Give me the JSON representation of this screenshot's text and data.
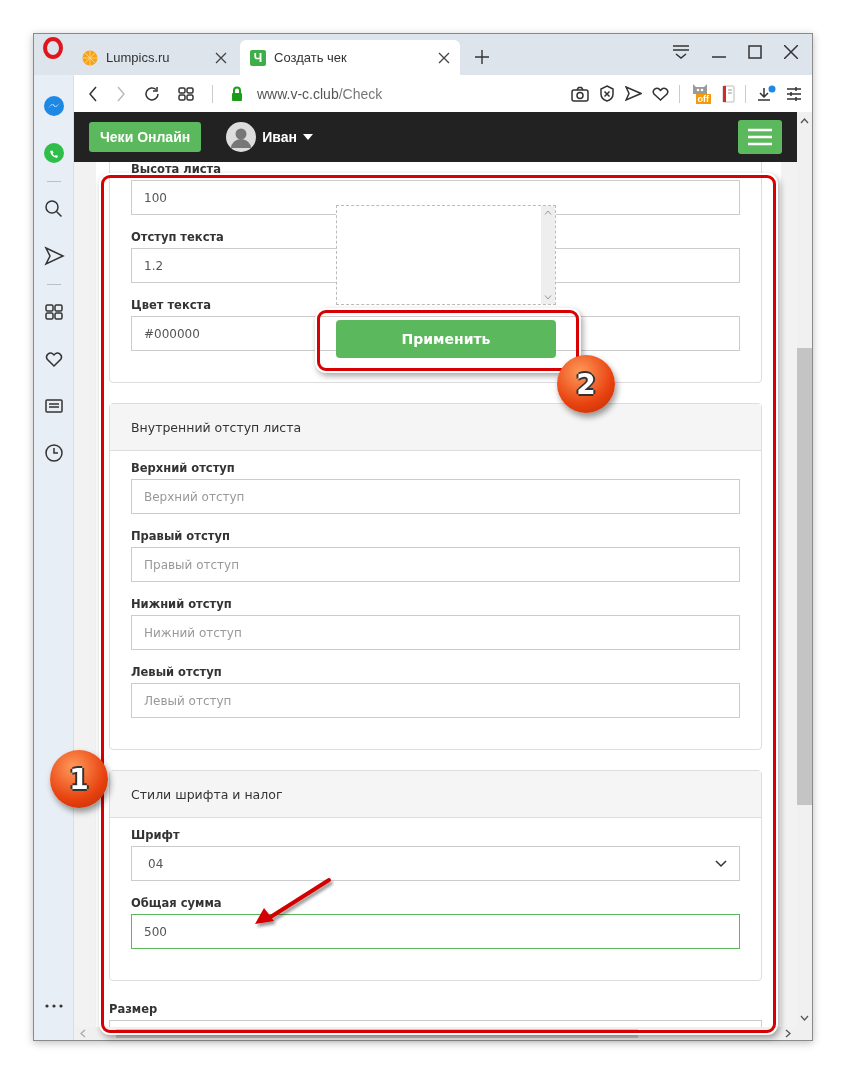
{
  "window": {
    "tabs": [
      {
        "title": "Lumpics.ru",
        "kind": "fruit",
        "selected": false
      },
      {
        "title": "Создать чек",
        "kind": "letter",
        "favicon_text": "Ч",
        "selected": true
      }
    ],
    "address": {
      "domain": "www.v-c.club",
      "path": "/Check"
    },
    "extension_badge": "off"
  },
  "navbar": {
    "brand": "Чеки Онлайн",
    "user": "Иван"
  },
  "panels": [
    {
      "fields": [
        {
          "label": "Высота листа",
          "kind": "input",
          "value": "100",
          "highlighted": false
        },
        {
          "label": "Отступ текста",
          "kind": "input",
          "value": "1.2",
          "highlighted": false
        },
        {
          "label": "Цвет текста",
          "kind": "input",
          "value": "#000000",
          "highlighted": false
        }
      ]
    },
    {
      "title": "Внутренний отступ листа",
      "fields": [
        {
          "label": "Верхний отступ",
          "kind": "input",
          "placeholder": "Верхний отступ",
          "highlighted": false
        },
        {
          "label": "Правый отступ",
          "kind": "input",
          "placeholder": "Правый отступ",
          "highlighted": false
        },
        {
          "label": "Нижний отступ",
          "kind": "input",
          "placeholder": "Нижний отступ",
          "highlighted": false
        },
        {
          "label": "Левый отступ",
          "kind": "input",
          "placeholder": "Левый отступ",
          "highlighted": false
        }
      ]
    },
    {
      "title": "Стили шрифта и налог",
      "fields": [
        {
          "label": "Шрифт",
          "kind": "select",
          "value": "04",
          "highlighted": false
        },
        {
          "label": "Общая сумма",
          "kind": "input",
          "value": "500",
          "highlighted": true
        }
      ]
    }
  ],
  "trailing_fields": [
    {
      "label": "Размер",
      "kind": "input",
      "highlighted": false
    }
  ],
  "popup": {
    "button": "Применить"
  },
  "annotations": [
    {
      "kind": "frame"
    },
    {
      "kind": "frame"
    },
    {
      "kind": "marker",
      "label": "1"
    },
    {
      "kind": "marker",
      "label": "2"
    },
    {
      "kind": "arrow"
    }
  ]
}
